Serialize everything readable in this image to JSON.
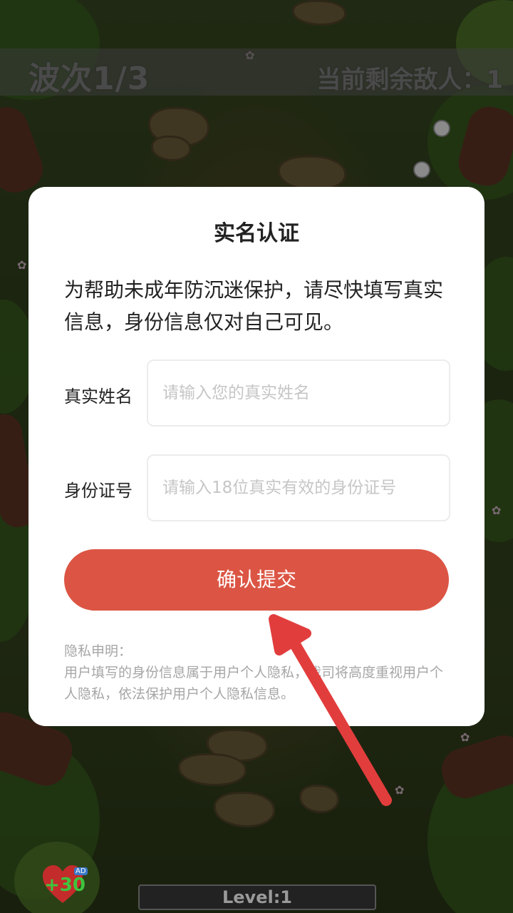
{
  "hud": {
    "wave_label": "波次1/3",
    "enemies_label": "当前剩余敌人：1"
  },
  "dialog": {
    "title": "实名认证",
    "description": "为帮助未成年防沉迷保护，请尽快填写真实信息，身份信息仅对自己可见。",
    "name_label": "真实姓名",
    "name_placeholder": "请输入您的真实姓名",
    "id_label": "身份证号",
    "id_placeholder": "请输入18位真实有效的身份证号",
    "submit_label": "确认提交",
    "privacy_title": "隐私申明：",
    "privacy_text": "用户填写的身份信息属于用户个人隐私，我司将高度重视用户个人隐私，依法保护用户个人隐私信息。"
  },
  "bottom_hud": {
    "health_bonus": "+30",
    "ad_badge": "AD",
    "level_label": "Level:1"
  },
  "colors": {
    "submit_button": "#dc5544",
    "arrow": "#e23d3d",
    "dialog_bg": "#ffffff"
  },
  "icons": {
    "heart": "heart-icon",
    "arrow": "pointer-arrow"
  }
}
